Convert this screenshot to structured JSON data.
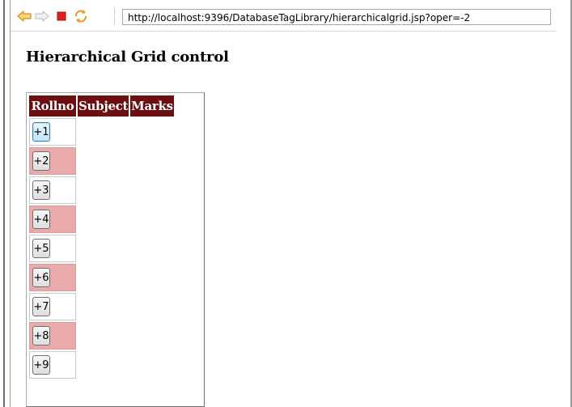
{
  "browser": {
    "url": "http://localhost:9396/DatabaseTagLibrary/hierarchicalgrid.jsp?oper=-2",
    "icons": [
      "back-arrow-icon",
      "forward-arrow-icon",
      "stop-icon",
      "refresh-icon"
    ],
    "colors": {
      "back": "#f0a63a",
      "stop": "#e02020",
      "refresh": "#f0a63a"
    }
  },
  "page": {
    "title": "Hierarchical Grid control"
  },
  "grid": {
    "columns": [
      "Rollno",
      "Subject",
      "Marks"
    ],
    "header_color": "#6b0f11",
    "alt_row_color": "#eaa9aa",
    "rows": [
      {
        "button": "+1",
        "alt": false,
        "focused": true
      },
      {
        "button": "+2",
        "alt": true,
        "focused": false
      },
      {
        "button": "+3",
        "alt": false,
        "focused": false
      },
      {
        "button": "+4",
        "alt": true,
        "focused": false
      },
      {
        "button": "+5",
        "alt": false,
        "focused": false
      },
      {
        "button": "+6",
        "alt": true,
        "focused": false
      },
      {
        "button": "+7",
        "alt": false,
        "focused": false
      },
      {
        "button": "+8",
        "alt": true,
        "focused": false
      },
      {
        "button": "+9",
        "alt": false,
        "focused": false
      }
    ]
  }
}
